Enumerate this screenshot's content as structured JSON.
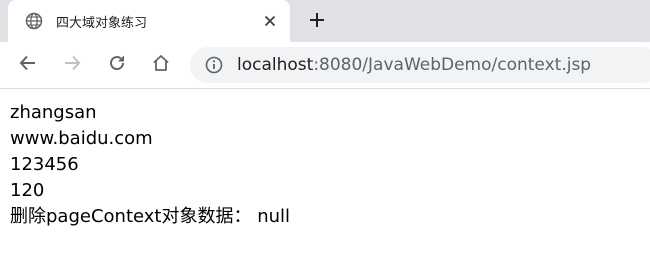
{
  "tab": {
    "title": "四大域对象练习",
    "globe_icon": "globe-icon",
    "close_icon": "close-icon"
  },
  "new_tab_icon": "plus-icon",
  "toolbar": {
    "back_icon": "arrow-left-icon",
    "forward_icon": "arrow-right-icon",
    "reload_icon": "reload-icon",
    "home_icon": "home-icon",
    "info_icon": "info-icon"
  },
  "address_bar": {
    "host": "localhost",
    "rest": ":8080/JavaWebDemo/context.jsp"
  },
  "page": {
    "lines": [
      "zhangsan",
      "www.baidu.com",
      "123456",
      "120",
      "删除pageContext对象数据： null"
    ]
  },
  "colors": {
    "tabstrip_bg": "#dfe1e5",
    "omnibox_bg": "#f1f3f4",
    "icon": "#5f6368"
  }
}
